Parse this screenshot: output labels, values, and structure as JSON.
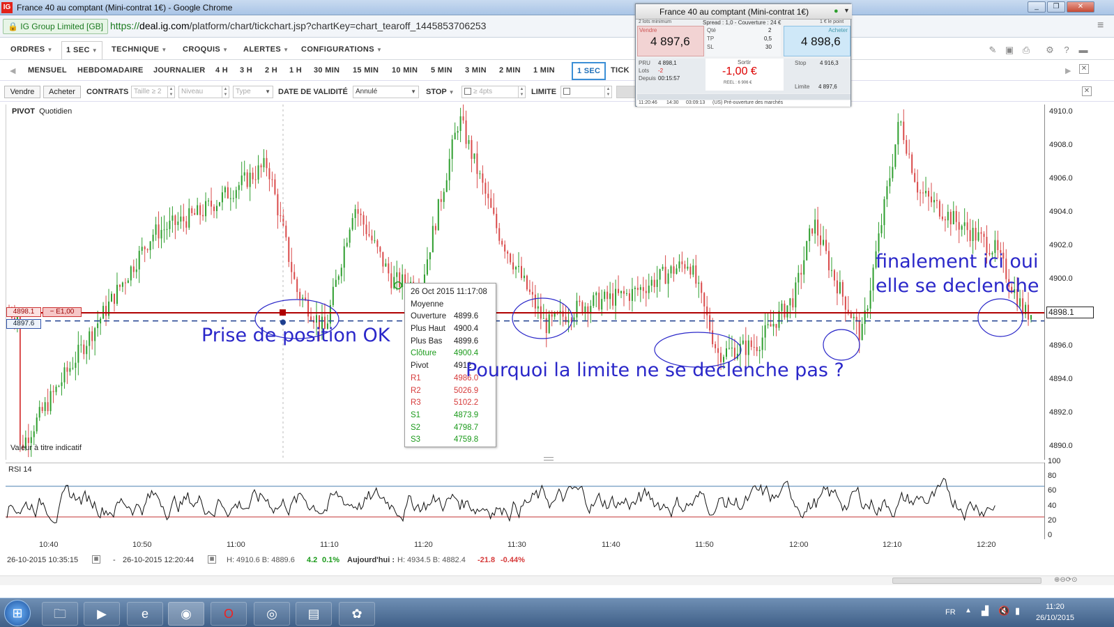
{
  "window": {
    "title": "France 40 au comptant (Mini-contrat 1€) - Google Chrome",
    "logo": "IG"
  },
  "address": {
    "security_badge": "IG Group Limited [GB]",
    "scheme": "https://",
    "host": "deal.ig.com",
    "path": "/platform/chart/tickchart.jsp?chartKey=chart_tearoff_1445853706253"
  },
  "menus": [
    {
      "label": "ORDRES"
    },
    {
      "label": "1 SEC"
    },
    {
      "label": "TECHNIQUE"
    },
    {
      "label": "CROQUIS"
    },
    {
      "label": "ALERTES"
    },
    {
      "label": "CONFIGURATIONS"
    }
  ],
  "timeframes": [
    "MENSUEL",
    "HEBDOMADAIRE",
    "JOURNALIER",
    "4 H",
    "3 H",
    "2 H",
    "1 H",
    "30 MIN",
    "15 MIN",
    "10 MIN",
    "5 MIN",
    "3 MIN",
    "2 MIN",
    "1 MIN",
    "1 SEC",
    "TICK"
  ],
  "active_timeframe": "1 SEC",
  "order_bar": {
    "sell": "Vendre",
    "buy": "Acheter",
    "contracts_label": "CONTRATS",
    "size_placeholder": "Taille ≥ 2",
    "level_placeholder": "Niveau",
    "type_placeholder": "Type",
    "validity_label": "DATE DE VALIDITÉ",
    "validity_value": "Annulé",
    "stop_label": "STOP",
    "stop_placeholder": "≥ 4pts",
    "limit_label": "LIMITE"
  },
  "chart": {
    "indicator_label": "PIVOT",
    "indicator_period": "Quotidien",
    "indicative_note": "Valeur à titre indicatif",
    "position_level": "4898.1",
    "position_pl": "− E1,00",
    "stop_level": "4897.6",
    "current_price": "4898.1",
    "rsi_label": "RSI 14",
    "price_ticks": [
      "4910.0",
      "4908.0",
      "4906.0",
      "4904.0",
      "4902.0",
      "4900.0",
      "4898.0",
      "4896.0",
      "4894.0",
      "4892.0",
      "4890.0"
    ],
    "rsi_ticks": [
      "100",
      "80",
      "60",
      "40",
      "20",
      "0"
    ],
    "time_ticks": [
      "10:40",
      "10:50",
      "11:00",
      "11:10",
      "11:20",
      "11:30",
      "11:40",
      "11:50",
      "12:00",
      "12:10",
      "12:20"
    ]
  },
  "chart_data": {
    "type": "candlestick",
    "instrument": "France 40 au comptant (Mini-contrat 1€)",
    "x_range": [
      "10:35",
      "12:22"
    ],
    "ylim": [
      4889.0,
      4911.0
    ],
    "key_prices": [
      {
        "time": "10:36",
        "price": 4889.6
      },
      {
        "time": "10:43",
        "price": 4896.3
      },
      {
        "time": "10:50",
        "price": 4903.0
      },
      {
        "time": "10:55",
        "price": 4904.3
      },
      {
        "time": "11:02",
        "price": 4907.3
      },
      {
        "time": "11:05",
        "price": 4899.5
      },
      {
        "time": "11:08",
        "price": 4897.0
      },
      {
        "time": "11:11",
        "price": 4904.8
      },
      {
        "time": "11:15",
        "price": 4900.1
      },
      {
        "time": "11:18",
        "price": 4899.8
      },
      {
        "time": "11:22",
        "price": 4910.2
      },
      {
        "time": "11:26",
        "price": 4903.2
      },
      {
        "time": "11:31",
        "price": 4897.3
      },
      {
        "time": "11:35",
        "price": 4898.6
      },
      {
        "time": "11:40",
        "price": 4899.3
      },
      {
        "time": "11:46",
        "price": 4901.3
      },
      {
        "time": "11:49",
        "price": 4895.6
      },
      {
        "time": "11:53",
        "price": 4896.1
      },
      {
        "time": "11:57",
        "price": 4899.1
      },
      {
        "time": "11:59",
        "price": 4903.8
      },
      {
        "time": "12:01",
        "price": 4900.5
      },
      {
        "time": "12:04",
        "price": 4896.6
      },
      {
        "time": "12:08",
        "price": 4910.1
      },
      {
        "time": "12:10",
        "price": 4905.6
      },
      {
        "time": "12:14",
        "price": 4903.7
      },
      {
        "time": "12:18",
        "price": 4902.0
      },
      {
        "time": "12:21",
        "price": 4898.1
      }
    ],
    "rsi": {
      "period": 14,
      "ylim": [
        0,
        100
      ],
      "overbought": 70,
      "oversold": 30
    },
    "position_line": 4898.1,
    "stop_line": 4897.6
  },
  "tooltip": {
    "date": "26 Oct 2015 11:17:08",
    "title": "Moyenne",
    "rows": [
      {
        "k": "Ouverture",
        "v": "4899.6",
        "color": "#222222"
      },
      {
        "k": "Plus Haut",
        "v": "4900.4",
        "color": "#222222"
      },
      {
        "k": "Plus Bas",
        "v": "4899.6",
        "color": "#222222"
      },
      {
        "k": "Clôture",
        "v": "4900.4",
        "color": "#1a9a1a"
      },
      {
        "k": "Pivot",
        "v": "4912",
        "color": "#222222"
      },
      {
        "k": "R1",
        "v": "4986.0",
        "color": "#d63a3a"
      },
      {
        "k": "R2",
        "v": "5026.9",
        "color": "#d63a3a"
      },
      {
        "k": "R3",
        "v": "5102.2",
        "color": "#d63a3a"
      },
      {
        "k": "S1",
        "v": "4873.9",
        "color": "#1a9a1a"
      },
      {
        "k": "S2",
        "v": "4798.7",
        "color": "#1a9a1a"
      },
      {
        "k": "S3",
        "v": "4759.8",
        "color": "#1a9a1a"
      }
    ]
  },
  "annotations": {
    "a1": "Prise de position OK",
    "a2": "Pourquoi la limite ne se declenche pas ?",
    "a3_line1": "finalement ici oui",
    "a3_line2": "elle se declenche"
  },
  "status": {
    "from": "26-10-2015 10:35:15",
    "sep": "-",
    "to": "26-10-2015 12:20:44",
    "hl": "H: 4910.6  B: 4889.6",
    "chg": "4.2",
    "chg_pct": "0.1%",
    "today_label": "Aujourd'hui :",
    "today_hl": "H: 4934.5  B: 4882.4",
    "today_chg": "-21.8",
    "today_pct": "-0.44%"
  },
  "deal_ticket": {
    "title": "France 40 au comptant (Mini-contrat 1€)",
    "spread": "Spread : 1,0 - Couverture : 24 €",
    "min_lots": "2 lots minimum",
    "point": "1 € le point",
    "sell_label": "Vendre",
    "sell_price": "4 897,6",
    "buy_label": "Acheter",
    "buy_price": "4 898,6",
    "qty_label": "Qté",
    "qty": "2",
    "tp_label": "TP",
    "tp": "0,5",
    "sl_label": "SL",
    "sl": "30",
    "pru_label": "PRU",
    "pru": "4 898,1",
    "lots_label": "Lots",
    "lots": "-2",
    "depuis_label": "Depuis",
    "depuis": "00:15:57",
    "exit_label": "Sortir",
    "pl": "-1,00 €",
    "pl_small": "REEL : 6 906 €",
    "stop_label": "Stop",
    "stop": "4 916,3",
    "limit_label": "Limite",
    "limit": "4 897,6",
    "footer_time": "11:20:46",
    "footer_t2": "14:30",
    "footer_t3": "03:09:13",
    "footer_status": "(US)  Pré-ouverture des marchés"
  },
  "taskbar": {
    "lang": "FR",
    "time": "11:20",
    "date": "26/10/2015"
  },
  "colors": {
    "up": "#2e9e2e",
    "down": "#d94a4a",
    "position": "#b00000",
    "stop_line": "#1e3f8f",
    "annotation": "#2a27c9",
    "accent": "#3b8fd6"
  }
}
